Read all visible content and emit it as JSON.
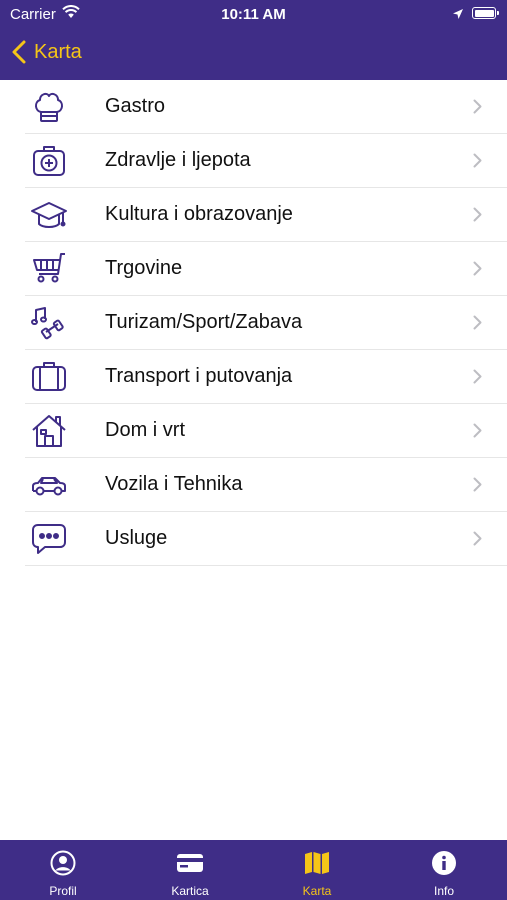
{
  "status_bar": {
    "carrier": "Carrier",
    "time": "10:11 AM"
  },
  "nav": {
    "back_label": "Karta"
  },
  "categories": [
    {
      "label": "Gastro",
      "icon": "chef-hat-icon"
    },
    {
      "label": "Zdravlje i ljepota",
      "icon": "first-aid-kit-icon"
    },
    {
      "label": "Kultura i obrazovanje",
      "icon": "graduation-cap-icon"
    },
    {
      "label": "Trgovine",
      "icon": "shopping-cart-icon"
    },
    {
      "label": "Turizam/Sport/Zabava",
      "icon": "music-dumbbell-icon"
    },
    {
      "label": "Transport i putovanja",
      "icon": "suitcase-icon"
    },
    {
      "label": "Dom i vrt",
      "icon": "house-icon"
    },
    {
      "label": "Vozila i Tehnika",
      "icon": "car-icon"
    },
    {
      "label": "Usluge",
      "icon": "chat-bubble-icon"
    }
  ],
  "tabs": [
    {
      "label": "Profil",
      "icon": "profile-icon"
    },
    {
      "label": "Kartica",
      "icon": "card-icon"
    },
    {
      "label": "Karta",
      "icon": "map-icon",
      "active": true
    },
    {
      "label": "Info",
      "icon": "info-icon"
    }
  ],
  "colors": {
    "brand": "#3f2d87",
    "accent": "#f5c518",
    "icon": "#3f2d87"
  }
}
